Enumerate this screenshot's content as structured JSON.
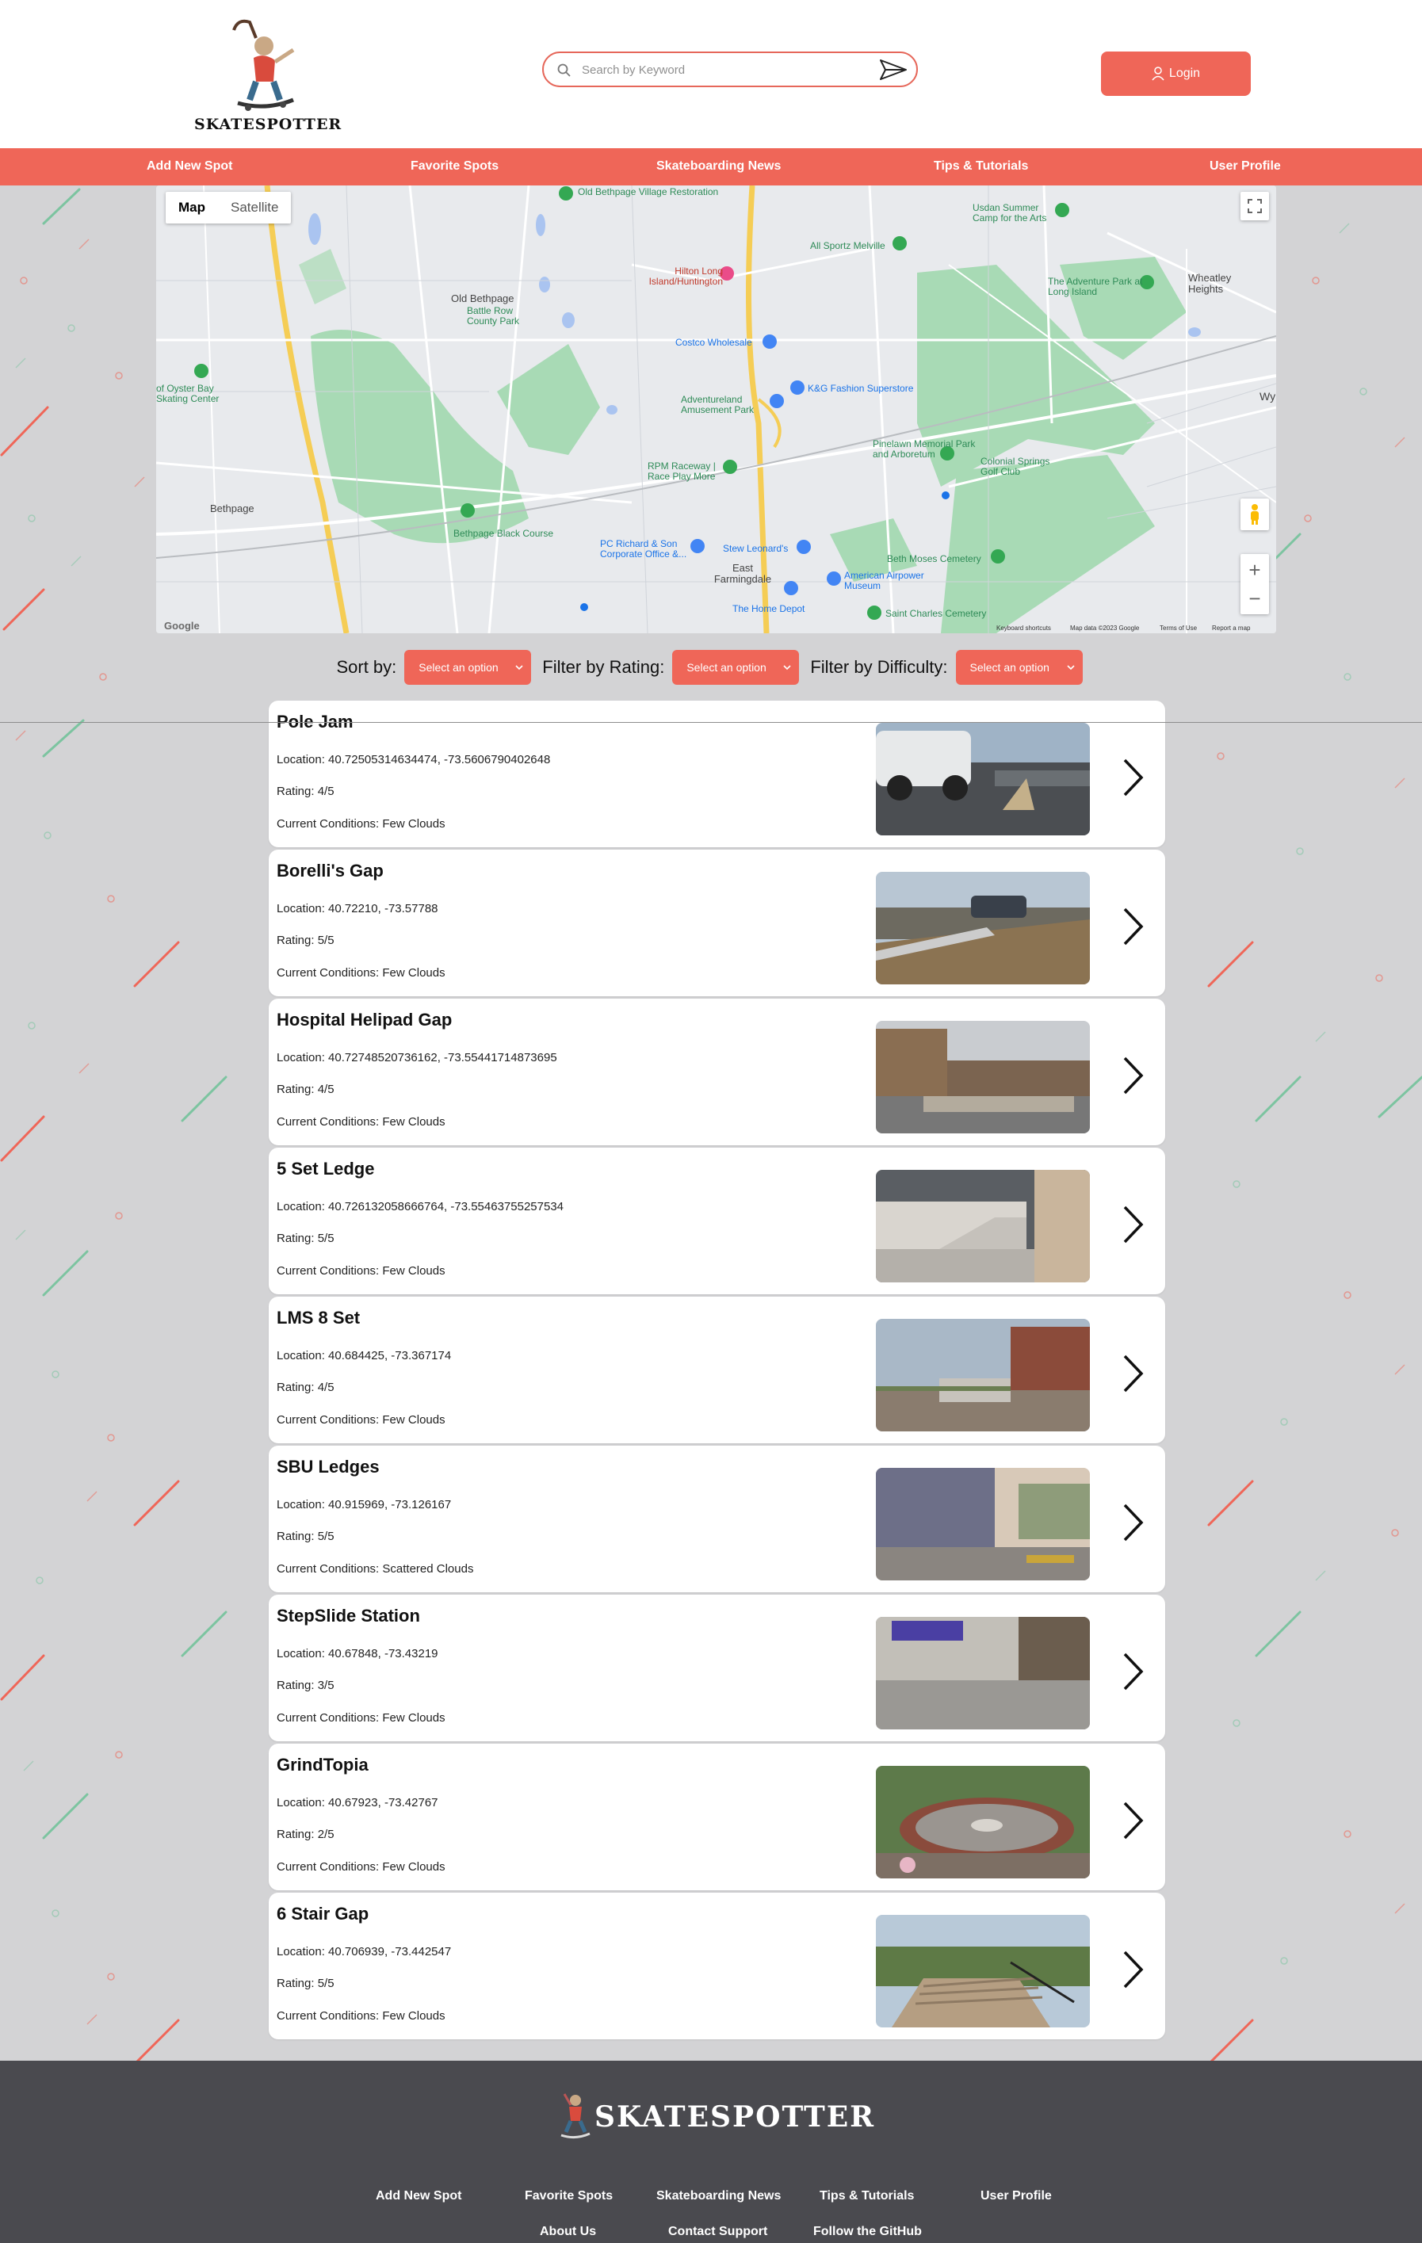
{
  "brand": {
    "name": "SKATESPOTTER",
    "accent": "#ef6658"
  },
  "search": {
    "placeholder": "Search by Keyword",
    "value": ""
  },
  "login": {
    "label": "Login"
  },
  "nav": [
    "Add New Spot",
    "Favorite Spots",
    "Skateboarding News",
    "Tips & Tutorials",
    "User Profile"
  ],
  "map": {
    "type_map": "Map",
    "type_satellite": "Satellite",
    "labels": [
      "Old Bethpage Village Restoration",
      "Usdan Summer Camp for the Arts",
      "All Sportz Melville",
      "Hilton Long Island/Huntington",
      "Old Bethpage",
      "Battle Row County Park",
      "The Adventure Park at Long Island",
      "Wheatley Heights",
      "Costco Wholesale",
      "K&G Fashion Superstore",
      "Adventureland Amusement Park",
      "of Oyster Bay Skating Center",
      "Pinelawn Memorial Park and Arboretum",
      "Colonial Springs Golf Club",
      "RPM Raceway | Race Play More",
      "Bethpage",
      "Bethpage Black Course",
      "PC Richard & Son Corporate Office &...",
      "Stew Leonard's",
      "Beth Moses Cemetery",
      "East Farmingdale",
      "American Airpower Museum",
      "The Home Depot",
      "Saint Charles Cemetery",
      "Wy"
    ],
    "footer": [
      "Keyboard shortcuts",
      "Map data ©2023 Google",
      "Terms of Use",
      "Report a map"
    ],
    "google": "Google"
  },
  "filters": {
    "sort_label": "Sort by:",
    "rating_label": "Filter by Rating:",
    "difficulty_label": "Filter by Difficulty:",
    "placeholder": "Select an option"
  },
  "spots": [
    {
      "name": "Pole Jam",
      "location": "Location: 40.72505314634474, -73.5606790402648",
      "rating": "Rating: 4/5",
      "conditions": "Current Conditions: Few Clouds"
    },
    {
      "name": "Borelli's Gap",
      "location": "Location: 40.72210, -73.57788",
      "rating": "Rating: 5/5",
      "conditions": "Current Conditions: Few Clouds"
    },
    {
      "name": "Hospital Helipad Gap",
      "location": "Location: 40.72748520736162, -73.55441714873695",
      "rating": "Rating: 4/5",
      "conditions": "Current Conditions: Few Clouds"
    },
    {
      "name": "5 Set Ledge",
      "location": "Location: 40.726132058666764, -73.55463755257534",
      "rating": "Rating: 5/5",
      "conditions": "Current Conditions: Few Clouds"
    },
    {
      "name": "LMS 8 Set",
      "location": "Location: 40.684425, -73.367174",
      "rating": "Rating: 4/5",
      "conditions": "Current Conditions: Few Clouds"
    },
    {
      "name": "SBU Ledges",
      "location": "Location: 40.915969, -73.126167",
      "rating": "Rating: 5/5",
      "conditions": "Current Conditions: Scattered Clouds"
    },
    {
      "name": "StepSlide Station",
      "location": "Location: 40.67848, -73.43219",
      "rating": "Rating: 3/5",
      "conditions": "Current Conditions: Few Clouds"
    },
    {
      "name": "GrindTopia",
      "location": "Location: 40.67923, -73.42767",
      "rating": "Rating: 2/5",
      "conditions": "Current Conditions: Few Clouds"
    },
    {
      "name": "6 Stair Gap",
      "location": "Location: 40.706939, -73.442547",
      "rating": "Rating: 5/5",
      "conditions": "Current Conditions: Few Clouds"
    }
  ],
  "footer": {
    "brand": "SKATESPOTTER",
    "links_row1": [
      "Add New Spot",
      "Favorite Spots",
      "Skateboarding News",
      "Tips & Tutorials",
      "User Profile"
    ],
    "links_row2": [
      "About Us",
      "Contact Support",
      "Follow the GitHub"
    ]
  }
}
